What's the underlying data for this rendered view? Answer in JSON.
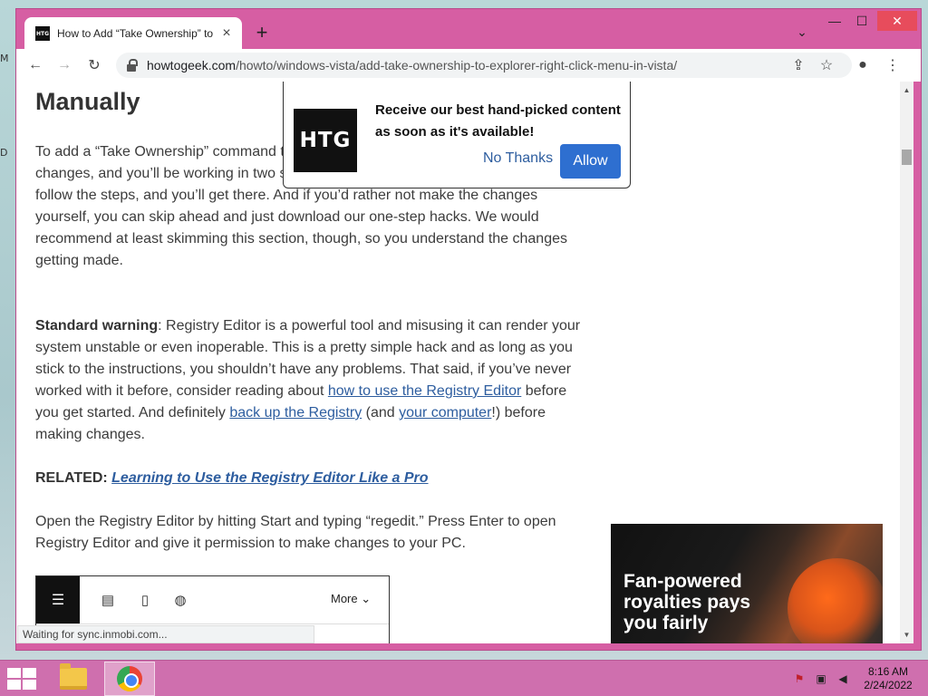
{
  "browser": {
    "tab_title": "How to Add “Take Ownership” to",
    "tab_favicon_text": "HTG",
    "url_host": "howtogeek.com",
    "url_path": "/howto/windows-vista/add-take-ownership-to-explorer-right-click-menu-in-vista/",
    "window_controls": {
      "minimize": "—",
      "maximize": "☐",
      "close": "✕"
    }
  },
  "article": {
    "heading": "Manually",
    "p1": "To add a “Take Ownership” command t you just need to make some changes i changes, and you’ll be working in two separate Registry locations. But take your time, follow the steps, and you’ll get there. And if you’d rather not make the changes yourself, you can skip ahead and just download our one-step hacks. We would recommend at least skimming this section, though, so you understand the changes getting made.",
    "p2_bold": "Standard warning",
    "p2_a": ": Registry Editor is a powerful tool and misusing it can render your system unstable or even inoperable. This is a pretty simple hack and as long as you stick to the instructions, you shouldn’t have any problems. That said, if you’ve never worked with it before, consider reading about ",
    "p2_link1": "how to use the Registry Editor",
    "p2_b": " before you get started. And definitely ",
    "p2_link2": "back up the Registry",
    "p2_c": " (and ",
    "p2_link3": "your computer",
    "p2_d": "!) before making changes.",
    "related_label": "RELATED: ",
    "related_link": "Learning to Use the Registry Editor Like a Pro",
    "p4": "Open the Registry Editor by hitting Start and typing “regedit.” Press Enter to open Registry Editor and give it permission to make changes to your PC."
  },
  "embed": {
    "more_label": "More"
  },
  "ad": {
    "text": "Fan-powered royalties pays you fairly"
  },
  "status_text": "Waiting for sync.inmobi.com...",
  "popup": {
    "logo": "HTG",
    "message": "Receive our best hand-picked content as soon as it's available!",
    "no_thanks": "No Thanks",
    "allow": "Allow"
  },
  "taskbar": {
    "time": "8:16 AM",
    "date": "2/24/2022"
  },
  "colors": {
    "frame": "#d65ea3",
    "taskbar": "#cf6fae",
    "link": "#2d5d9f",
    "allow": "#2e6fd0"
  }
}
